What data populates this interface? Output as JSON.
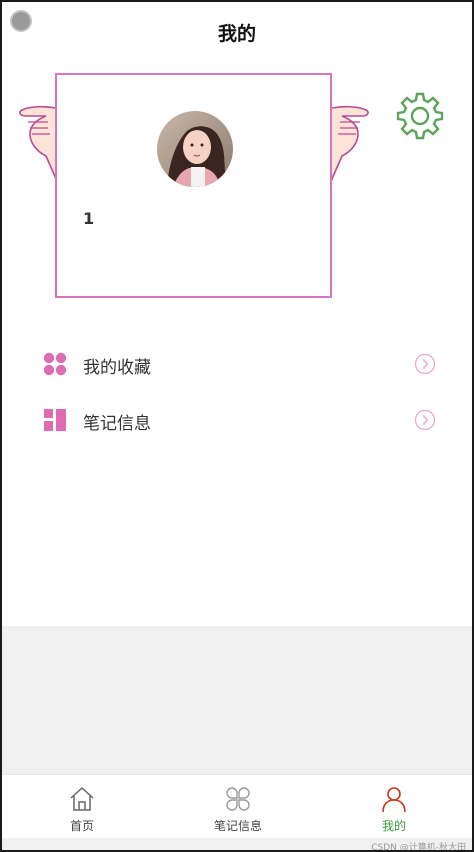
{
  "header": {
    "title": "我的"
  },
  "profile": {
    "username": "1",
    "avatar": "avatar-photo"
  },
  "settings": {
    "icon": "gear-icon",
    "color": "#5aa55a"
  },
  "menu": [
    {
      "label": "我的收藏",
      "icon": "four-dots-icon"
    },
    {
      "label": "笔记信息",
      "icon": "grid-icon"
    }
  ],
  "tabbar": {
    "tabs": [
      {
        "label": "首页",
        "icon": "home-icon"
      },
      {
        "label": "笔记信息",
        "icon": "clover-icon"
      },
      {
        "label": "我的",
        "icon": "person-icon",
        "active": true
      }
    ]
  },
  "watermark": "CSDN @计算机-秋大田",
  "colors": {
    "accent": "#e06bb5",
    "card_border": "#d674c2",
    "active_tab": "#3a9b3a",
    "active_icon": "#c9371e"
  }
}
